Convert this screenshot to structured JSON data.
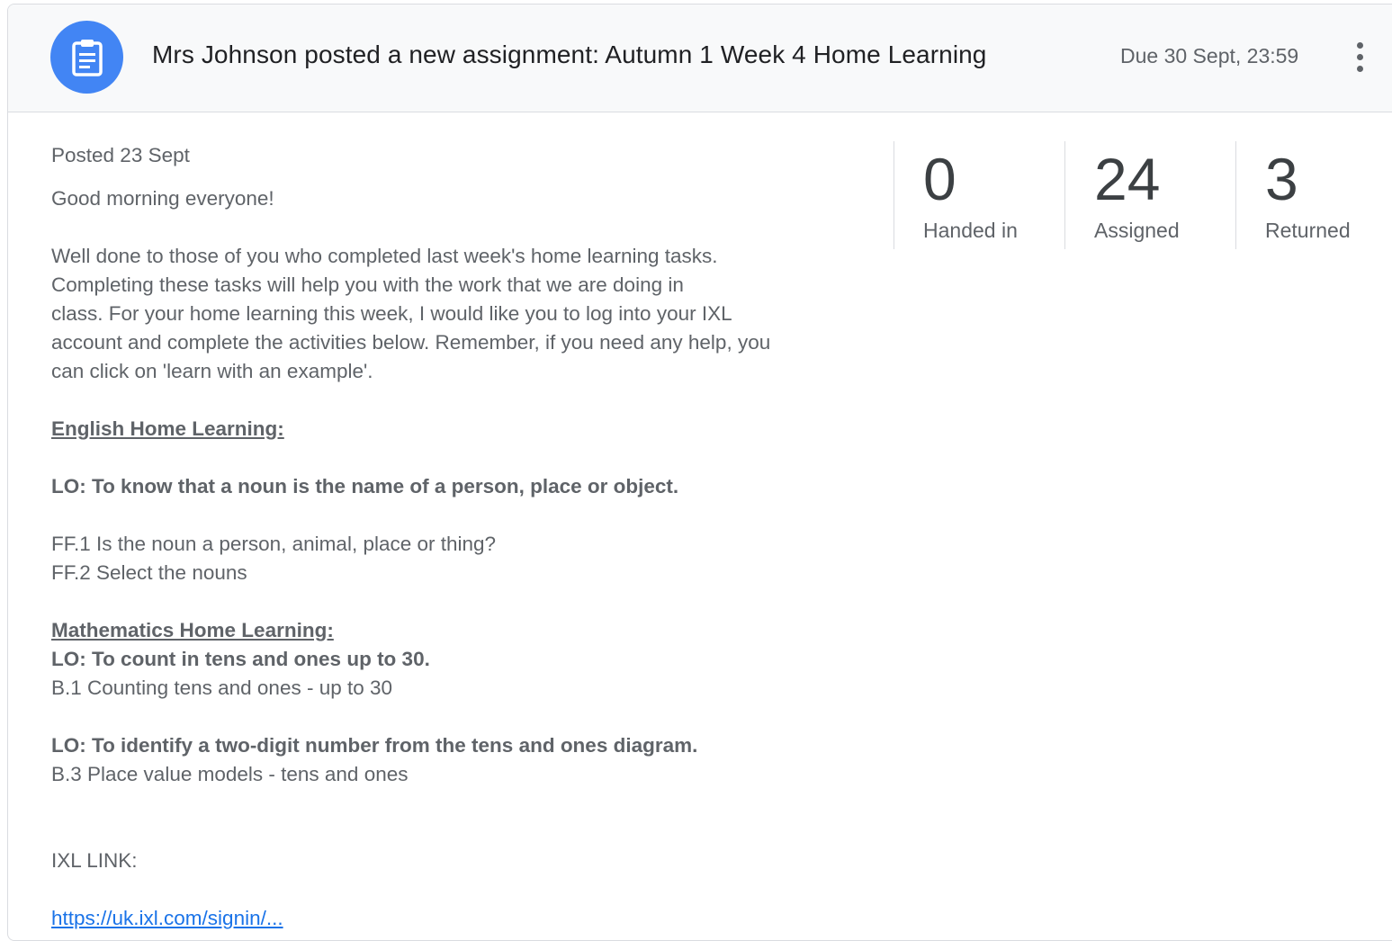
{
  "header": {
    "title": "Mrs Johnson posted a new assignment: Autumn 1 Week 4 Home Learning",
    "due": "Due 30 Sept, 23:59",
    "icon": "assignment-icon",
    "accent_color": "#4285f4"
  },
  "post": {
    "posted": "Posted 23 Sept",
    "greeting": "Good morning everyone!",
    "intro_lines": [
      "Well done to those of you who completed last week's home learning tasks.",
      "Completing these tasks will help you with the work that we are doing in",
      "class. For your home learning this week, I would like you to log into your IXL",
      "account and complete the activities below. Remember, if you need any help, you",
      "can click on 'learn with an example'."
    ],
    "english_heading": "English Home Learning:",
    "english_lo": "LO: To know that a noun is the name of a person, place or object.",
    "english_tasks": [
      "FF.1 Is the noun a person, animal, place or thing?",
      "FF.2 Select the nouns"
    ],
    "maths_heading": "Mathematics Home Learning:",
    "maths_lo1": "LO: To count in tens and ones up to 30.",
    "maths_task1": "B.1 Counting tens and ones - up to 30",
    "maths_lo2": "LO: To identify a two-digit number from the tens and ones diagram.",
    "maths_task2": "B.3 Place value models - tens and ones",
    "ixl_label": "IXL LINK:",
    "ixl_link": "https://uk.ixl.com/signin/..."
  },
  "stats": [
    {
      "value": "0",
      "label": "Handed in"
    },
    {
      "value": "24",
      "label": "Assigned"
    },
    {
      "value": "3",
      "label": "Returned"
    }
  ]
}
